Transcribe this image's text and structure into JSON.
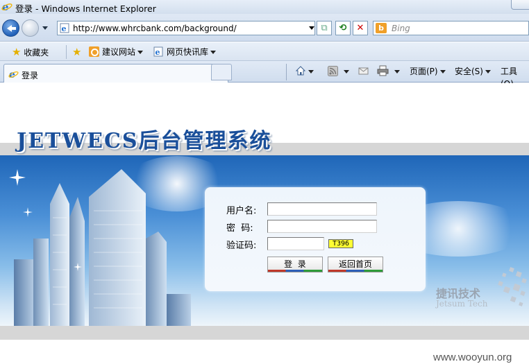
{
  "window": {
    "title": "登录 - Windows Internet Explorer"
  },
  "toolbar": {
    "url_prefix": "http://www.",
    "url_host": "whrcbank.com",
    "url_path": "/background/",
    "search_placeholder": "Bing"
  },
  "favorites": {
    "favorites_label": "收藏夹",
    "suggested_sites_label": "建议网站",
    "web_slice_gallery_label": "网页快讯库"
  },
  "tabs": [
    {
      "label": "登录"
    }
  ],
  "command_bar": {
    "page_label": "页面(P)",
    "safety_label": "安全(S)",
    "tools_label": "工具(O)"
  },
  "page": {
    "header_title": "JETWECS后台管理系统",
    "login": {
      "username_label": "用户名:",
      "password_label": "密  码:",
      "captcha_label": "验证码:",
      "username_value": "",
      "password_value": "",
      "captcha_value": "",
      "captcha_code": "T396",
      "login_button": "登  录",
      "home_button": "返回首页"
    },
    "brand_name": "捷讯技术",
    "brand_sub": "Jetsum Tech"
  },
  "watermark": "www.wooyun.org"
}
